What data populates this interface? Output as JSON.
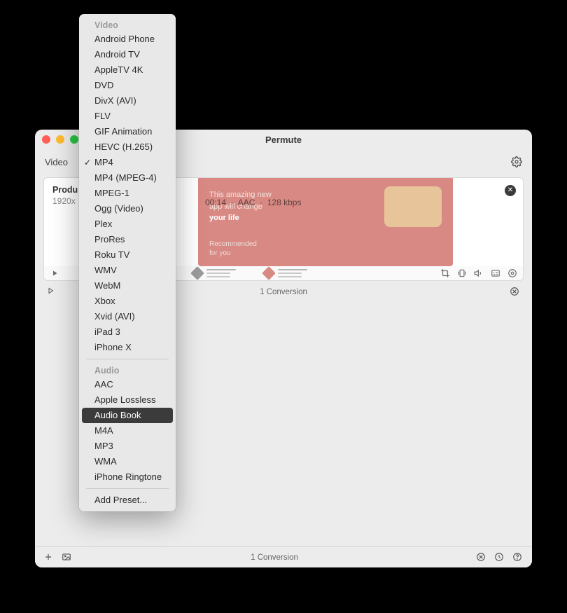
{
  "window": {
    "title": "Permute"
  },
  "toolbar": {
    "left_label": "Video"
  },
  "file": {
    "name": "Produ",
    "resolution": "1920x",
    "duration": "00:14",
    "audio_codec": "AAC",
    "bitrate": "128 kbps",
    "preview_line1": "This amazing new",
    "preview_line2": "app will change",
    "preview_line3": "your life",
    "rec_line1": "Recommended",
    "rec_line2": "for you"
  },
  "conversion_row": {
    "label": "1 Conversion"
  },
  "footer": {
    "label": "1 Conversion"
  },
  "menu": {
    "video_header": "Video",
    "video_items": [
      "Android Phone",
      "Android TV",
      "AppleTV 4K",
      "DVD",
      "DivX (AVI)",
      "FLV",
      "GIF Animation",
      "HEVC (H.265)",
      "MP4",
      "MP4 (MPEG-4)",
      "MPEG-1",
      "Ogg (Video)",
      "Plex",
      "ProRes",
      "Roku TV",
      "WMV",
      "WebM",
      "Xbox",
      "Xvid (AVI)",
      "iPad 3",
      "iPhone X"
    ],
    "checked": "MP4",
    "audio_header": "Audio",
    "audio_items": [
      "AAC",
      "Apple Lossless",
      "Audio Book",
      "M4A",
      "MP3",
      "WMA",
      "iPhone Ringtone"
    ],
    "highlighted": "Audio Book",
    "add_preset": "Add Preset..."
  }
}
